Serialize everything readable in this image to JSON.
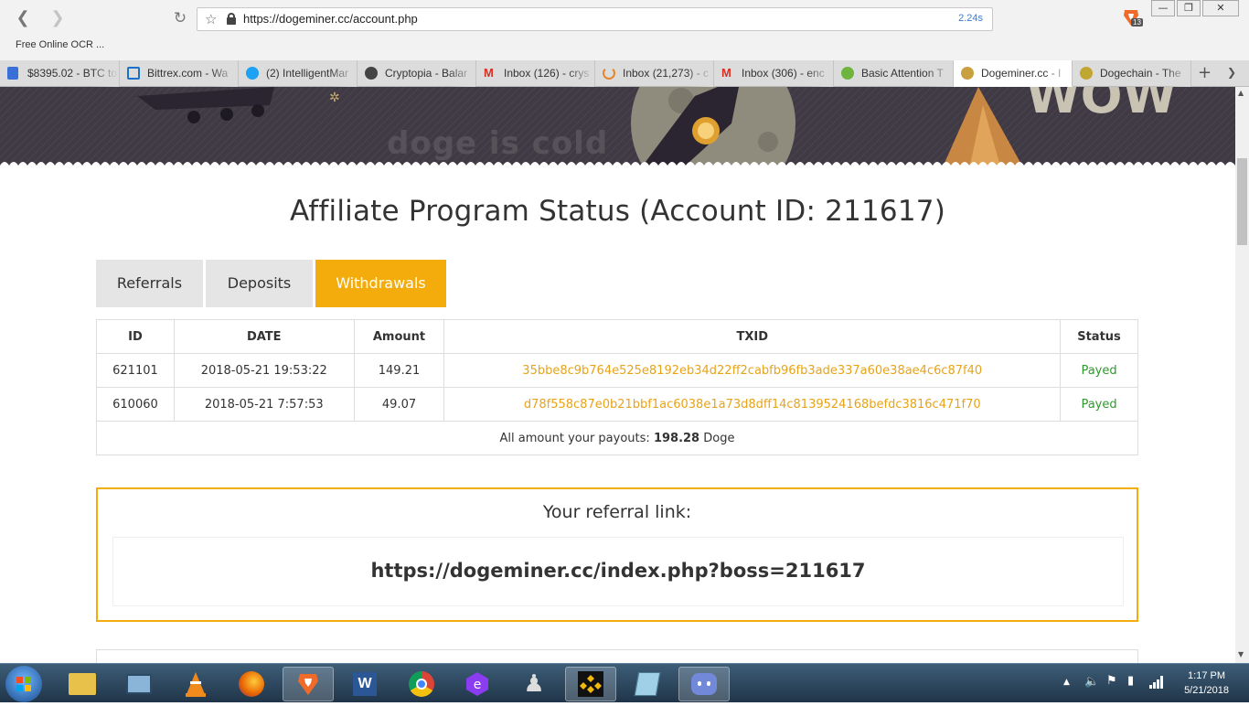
{
  "browser": {
    "url": "https://dogeminer.cc/account.php",
    "load_time": "2.24s",
    "bookmark": "Free Online OCR ...",
    "extension_badge": "13",
    "tabs": [
      {
        "label": "$8395.02 - BTC to",
        "icon_color": "#3a6fd8"
      },
      {
        "label": "Bittrex.com - Wa",
        "icon_color": "#1a73c8"
      },
      {
        "label": "(2) IntelligentMar",
        "icon_color": "#1da1f2"
      },
      {
        "label": "Cryptopia - Balar",
        "icon_color": "#444444"
      },
      {
        "label": "Inbox (126) - crys",
        "icon_color": "#d93025"
      },
      {
        "label": "Inbox (21,273) - c",
        "icon_color": "#e6862a"
      },
      {
        "label": "Inbox (306) - enc",
        "icon_color": "#d93025"
      },
      {
        "label": "Basic Attention T",
        "icon_color": "#6fb43f"
      },
      {
        "label": "Dogeminer.cc - I",
        "icon_color": "#c8a040"
      },
      {
        "label": "Dogechain - The",
        "icon_color": "#c2a633"
      }
    ]
  },
  "hero": {
    "text": "doge is cold",
    "wow": "wow"
  },
  "page": {
    "title": "Affiliate Program Status (Account ID: 211617)",
    "tabs": [
      "Referrals",
      "Deposits",
      "Withdrawals"
    ],
    "table": {
      "headers": [
        "ID",
        "DATE",
        "Amount",
        "TXID",
        "Status"
      ],
      "rows": [
        [
          "621101",
          "2018-05-21 19:53:22",
          "149.21",
          "35bbe8c9b764e525e8192eb34d22ff2cabfb96fb3ade337a60e38ae4c6c87f40",
          "Payed"
        ],
        [
          "610060",
          "2018-05-21 7:57:53",
          "49.07",
          "d78f558c87e0b21bbf1ac6038e1a73d8dff14c8139524168befdc3816c471f70",
          "Payed"
        ]
      ],
      "total_prefix": "All amount your payouts:",
      "total_value": "198.28",
      "total_unit": "Doge"
    },
    "referral": {
      "label": "Your referral link:",
      "url": "https://dogeminer.cc/index.php?boss=211617"
    }
  },
  "taskbar": {
    "time": "1:17 PM",
    "date": "5/21/2018"
  },
  "colors": {
    "accent": "#f4ac0c",
    "txid": "#e8a319",
    "status_ok": "#2e9a2e"
  }
}
